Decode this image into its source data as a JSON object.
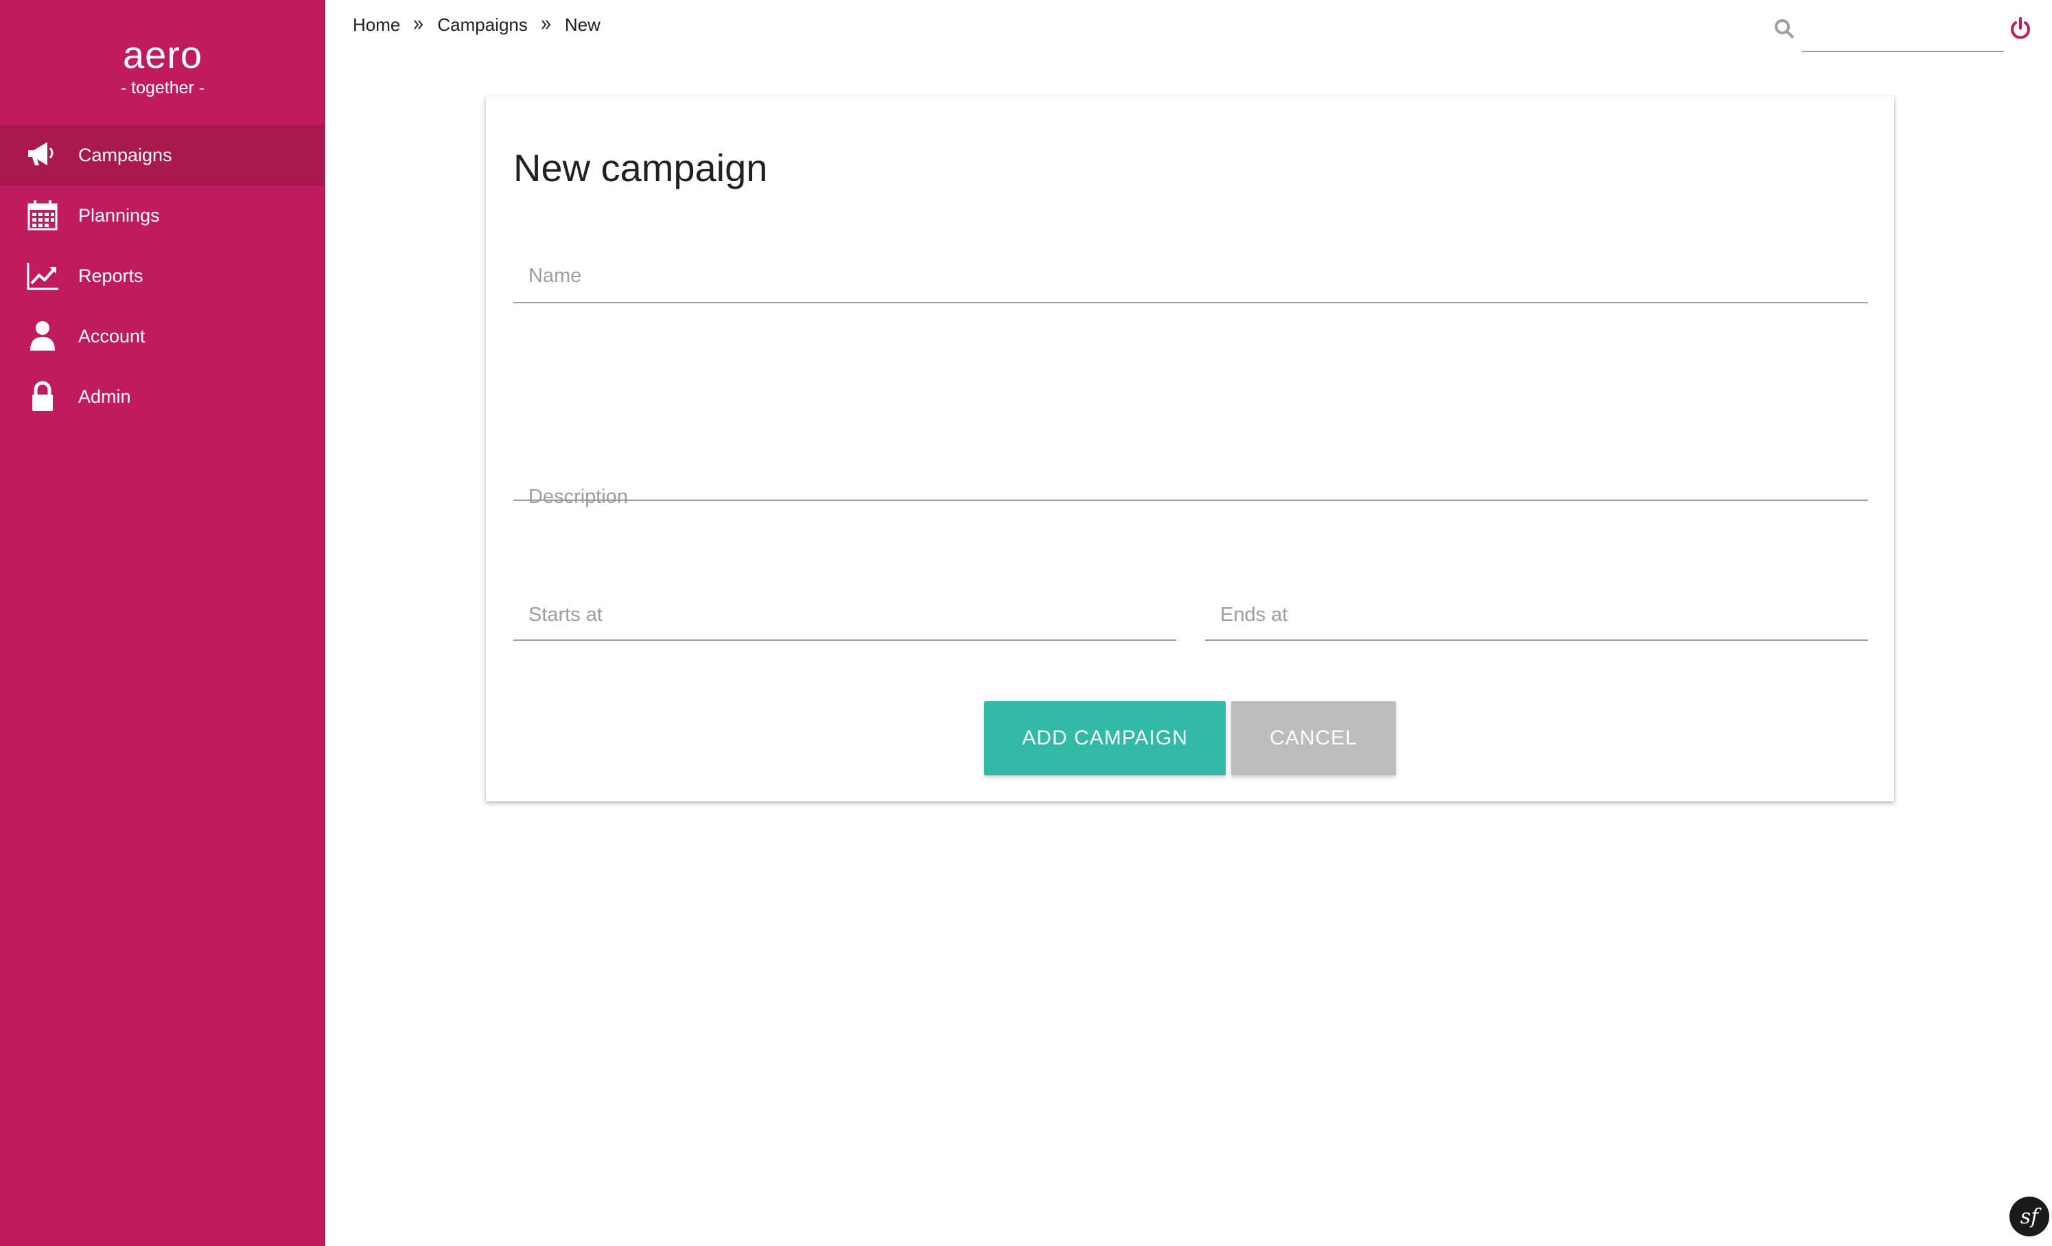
{
  "brand": {
    "name": "aero",
    "tagline": "- together -"
  },
  "sidebar": {
    "items": [
      {
        "label": "Campaigns",
        "icon": "megaphone-icon",
        "active": true
      },
      {
        "label": "Plannings",
        "icon": "calendar-icon",
        "active": false
      },
      {
        "label": "Reports",
        "icon": "line-chart-icon",
        "active": false
      },
      {
        "label": "Account",
        "icon": "user-icon",
        "active": false
      },
      {
        "label": "Admin",
        "icon": "lock-icon",
        "active": false
      }
    ]
  },
  "breadcrumb": {
    "items": [
      "Home",
      "Campaigns",
      "New"
    ]
  },
  "topbar": {
    "search_placeholder": "",
    "search_icon": "search-icon",
    "logout_icon": "power-icon"
  },
  "form": {
    "title": "New campaign",
    "name_label": "Name",
    "description_label": "Description",
    "starts_label": "Starts at",
    "ends_label": "Ends at",
    "submit_label": "ADD CAMPAIGN",
    "cancel_label": "CANCEL"
  },
  "colors": {
    "sidebar": "#c01b5c",
    "sidebar_active": "#a9184f",
    "primary_button": "#33b9a7",
    "cancel_button": "#bdbdbd",
    "logout_icon": "#c01b5c"
  },
  "debug_badge": {
    "icon": "symfony-icon",
    "text": "sf"
  }
}
